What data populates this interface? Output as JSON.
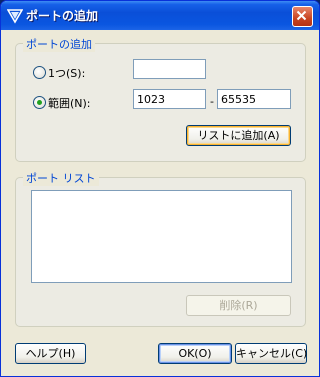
{
  "window": {
    "title": "ポートの追加"
  },
  "add_port": {
    "group_title": "ポートの追加",
    "single": {
      "label": "1つ(S):",
      "value": "",
      "selected": false
    },
    "range": {
      "label": "範囲(N):",
      "from": "1023",
      "separator": "-",
      "to": "65535",
      "selected": true
    },
    "add_to_list_label": "リストに追加(A)"
  },
  "port_list": {
    "group_title": "ポート リスト",
    "items": [],
    "delete_label": "削除(R)"
  },
  "buttons": {
    "help": "ヘルプ(H)",
    "ok": "OK(O)",
    "cancel": "キャンセル(C)"
  },
  "colors": {
    "titlebar": "#0a4fd8",
    "group_title": "#0046d5",
    "dialog_bg": "#ece9d8"
  }
}
